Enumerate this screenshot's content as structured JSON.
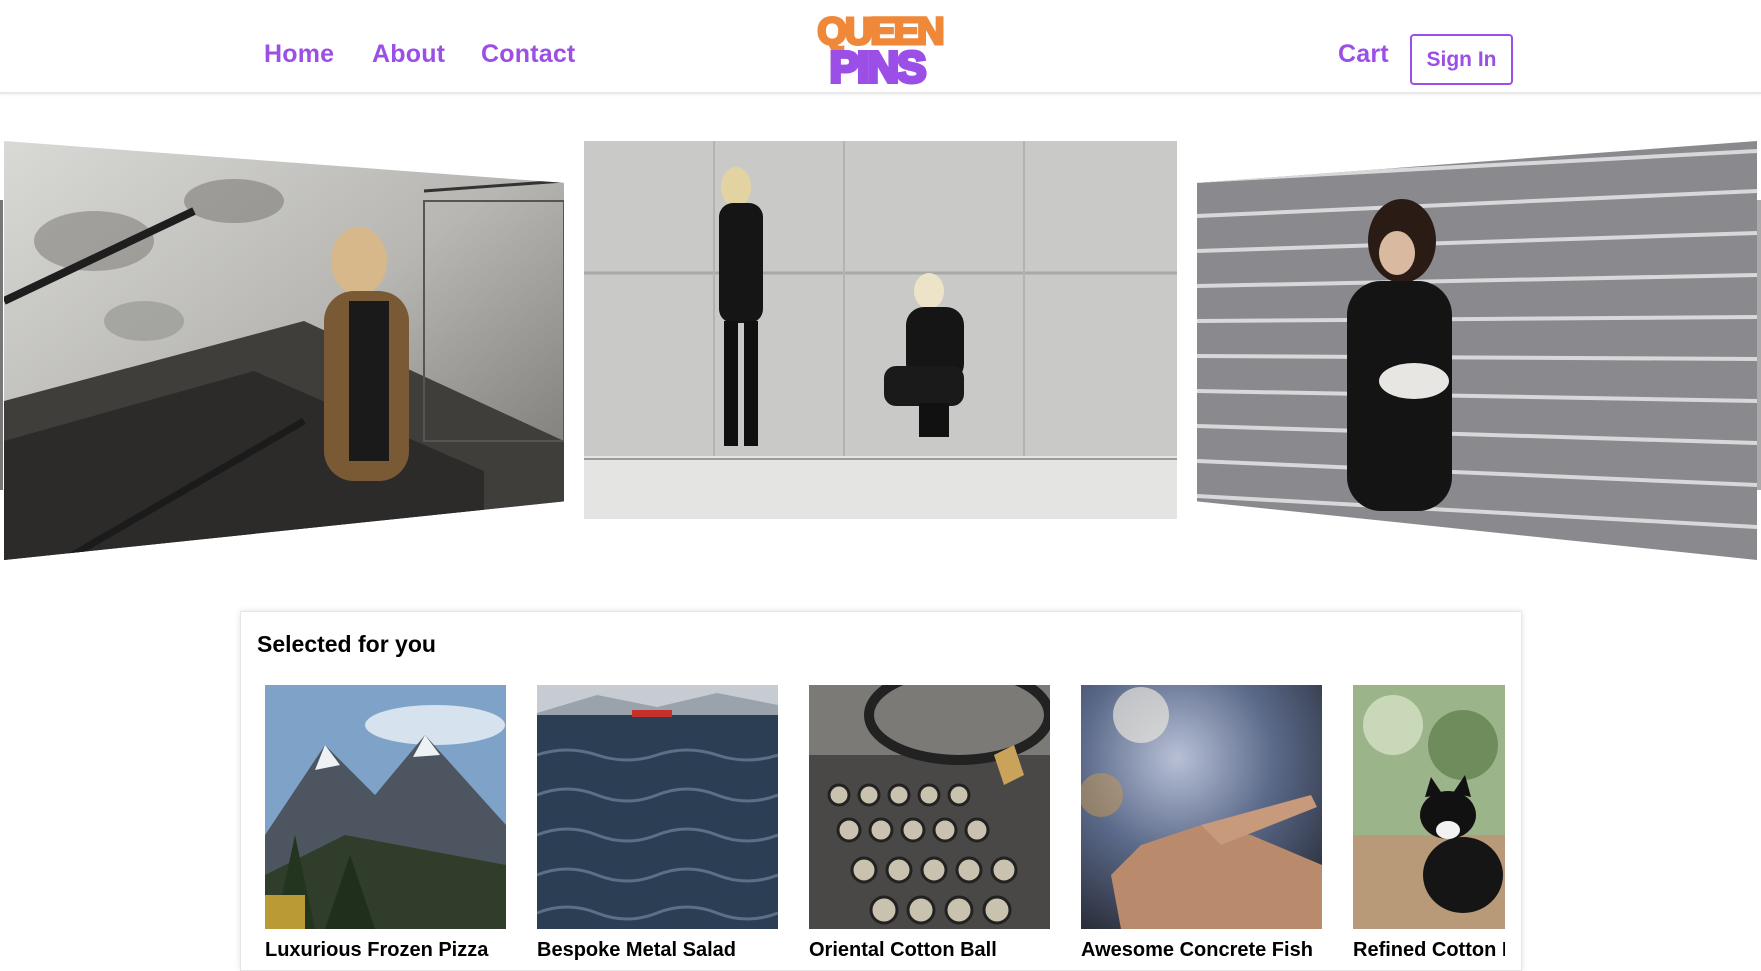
{
  "header": {
    "nav_left": [
      "Home",
      "About",
      "Contact"
    ],
    "logo_top": "QUEEN",
    "logo_bottom": "PINS",
    "cart_label": "Cart",
    "signin_label": "Sign In"
  },
  "hero": {
    "slides": [
      {
        "subject": "woman in leopard coat on staircase"
      },
      {
        "subject": "two models in black against concrete wall"
      },
      {
        "subject": "woman with fanny pack against metal wall"
      }
    ]
  },
  "selected": {
    "title": "Selected for you",
    "products": [
      {
        "name": "Luxurious Frozen Pizza"
      },
      {
        "name": "Bespoke Metal Salad"
      },
      {
        "name": "Oriental Cotton Ball"
      },
      {
        "name": "Awesome Concrete Fish"
      },
      {
        "name": "Refined Cotton Bike"
      }
    ]
  },
  "colors": {
    "accent": "#9b4fe6",
    "logo_orange": "#f0883a",
    "logo_purple": "#9b4fe6"
  }
}
